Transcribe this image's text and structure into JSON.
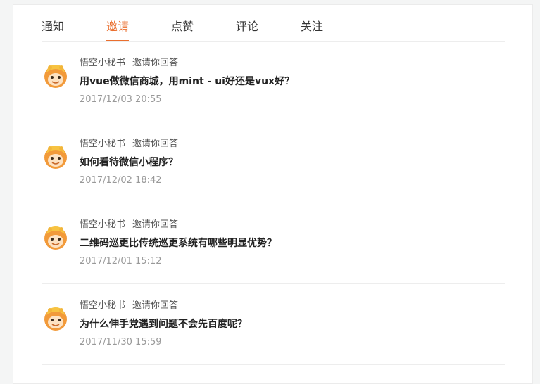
{
  "tabs": [
    {
      "label": "通知",
      "active": false
    },
    {
      "label": "邀请",
      "active": true
    },
    {
      "label": "点赞",
      "active": false
    },
    {
      "label": "评论",
      "active": false
    },
    {
      "label": "关注",
      "active": false
    }
  ],
  "accent_color": "#ea6f2f",
  "avatar_icon": "monkey-avatar-icon",
  "items": [
    {
      "user": "悟空小秘书",
      "action": "邀请你回答",
      "question": "用vue做微信商城，用mint - ui好还是vux好？",
      "time": "2017/12/03 20:55"
    },
    {
      "user": "悟空小秘书",
      "action": "邀请你回答",
      "question": "如何看待微信小程序？",
      "time": "2017/12/02 18:42"
    },
    {
      "user": "悟空小秘书",
      "action": "邀请你回答",
      "question": "二维码巡更比传统巡更系统有哪些明显优势？",
      "time": "2017/12/01 15:12"
    },
    {
      "user": "悟空小秘书",
      "action": "邀请你回答",
      "question": "为什么伸手党遇到问题不会先百度呢？",
      "time": "2017/11/30 15:59"
    }
  ]
}
